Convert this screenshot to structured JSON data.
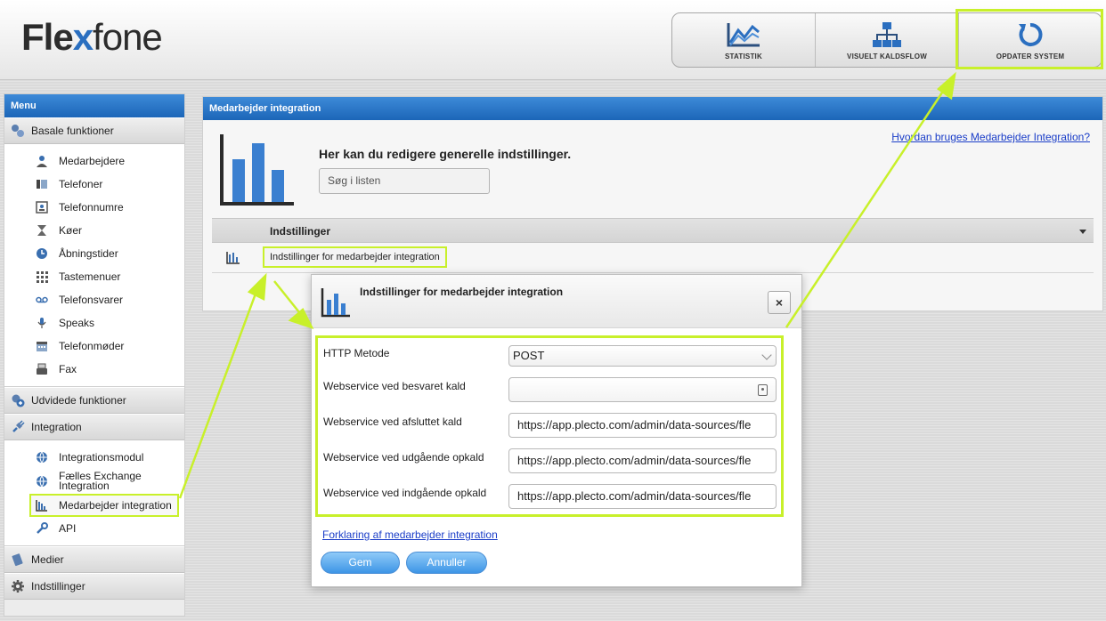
{
  "colors": {
    "accent": "#1c66b8",
    "highlight": "#c8f02a",
    "link": "#1a3dc8"
  },
  "header": {
    "logo": {
      "part1": "Fle",
      "part2": "x",
      "part3": "fone"
    },
    "buttons": [
      {
        "label": "STATISTIK",
        "icon": "chart-line-icon"
      },
      {
        "label": "VISUELT KALDSFLOW",
        "icon": "flow-icon"
      },
      {
        "label": "OPDATER SYSTEM",
        "icon": "refresh-icon"
      }
    ]
  },
  "sidebar": {
    "title": "Menu",
    "sections": [
      {
        "label": "Basale funktioner",
        "items": [
          "Medarbejdere",
          "Telefoner",
          "Telefonnumre",
          "Køer",
          "Åbningstider",
          "Tastemenuer",
          "Telefonsvarer",
          "Speaks",
          "Telefonmøder",
          "Fax"
        ]
      },
      {
        "label": "Udvidede funktioner"
      },
      {
        "label": "Integration",
        "items": [
          "Integrationsmodul",
          "Fælles Exchange Integration",
          "Medarbejder integration",
          "API"
        ]
      },
      {
        "label": "Medier"
      },
      {
        "label": "Indstillinger"
      }
    ],
    "exchange_line1": "Fælles Exchange",
    "exchange_line2": "Integration"
  },
  "main": {
    "title": "Medarbejder integration",
    "heading": "Her kan du redigere generelle indstillinger.",
    "search_placeholder": "Søg i listen",
    "help_link": "Hvordan bruges Medarbejder Integration?",
    "list_header": "Indstillinger",
    "row_label": "Indstillinger for medarbejder integration"
  },
  "modal": {
    "title": "Indstillinger for medarbejder integration",
    "close": "×",
    "fields": [
      {
        "label": "HTTP Metode",
        "value": "POST"
      },
      {
        "label": "Webservice ved besvaret kald",
        "value": ""
      },
      {
        "label": "Webservice ved afsluttet kald",
        "value": "https://app.plecto.com/admin/data-sources/fle"
      },
      {
        "label": "Webservice ved udgående opkald",
        "value": "https://app.plecto.com/admin/data-sources/fle"
      },
      {
        "label": "Webservice ved indgående opkald",
        "value": "https://app.plecto.com/admin/data-sources/fle"
      }
    ],
    "link": "Forklaring af medarbejder integration",
    "save": "Gem",
    "cancel": "Annuller"
  }
}
